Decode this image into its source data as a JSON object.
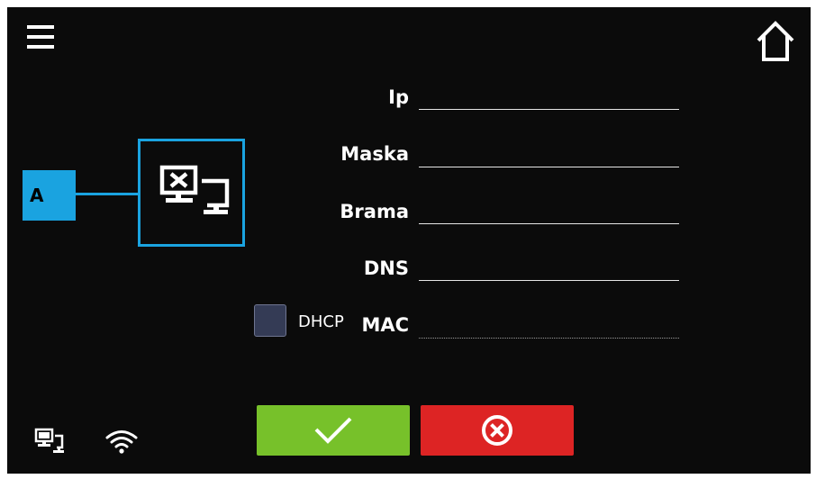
{
  "header": {
    "menu_icon": "hamburger-menu-icon",
    "home_icon": "home-icon"
  },
  "network": {
    "status_icon": "network-disconnected-icon",
    "callout_label": "A",
    "accent_color": "#1aa3e0"
  },
  "form": {
    "ip": {
      "label": "Ip",
      "value": ""
    },
    "mask": {
      "label": "Maska",
      "value": ""
    },
    "gateway": {
      "label": "Brama",
      "value": ""
    },
    "dns": {
      "label": "DNS",
      "value": ""
    },
    "mac": {
      "label": "MAC",
      "value": ""
    },
    "dhcp": {
      "label": "DHCP",
      "checked": false
    }
  },
  "actions": {
    "confirm_icon": "checkmark-icon",
    "confirm_color": "#77c12a",
    "cancel_icon": "cancel-circle-x-icon",
    "cancel_color": "#dd2424"
  },
  "status_bar": {
    "lan_icon": "lan-icon",
    "wifi_icon": "wifi-icon"
  }
}
